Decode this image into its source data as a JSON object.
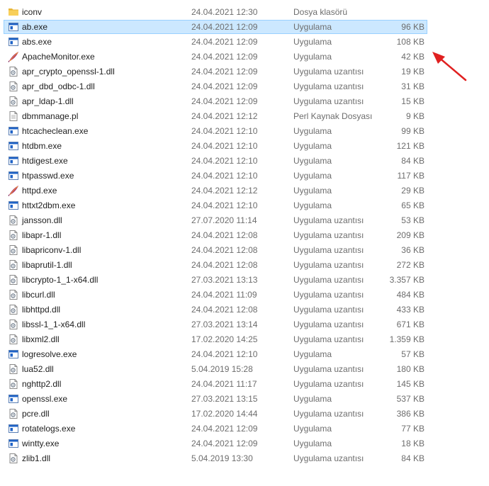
{
  "files": [
    {
      "name": "iconv",
      "date": "24.04.2021 12:30",
      "type": "Dosya klasörü",
      "size": "",
      "icon": "folder-icon",
      "selected": false
    },
    {
      "name": "ab.exe",
      "date": "24.04.2021 12:09",
      "type": "Uygulama",
      "size": "96 KB",
      "icon": "app-icon",
      "selected": true
    },
    {
      "name": "abs.exe",
      "date": "24.04.2021 12:09",
      "type": "Uygulama",
      "size": "108 KB",
      "icon": "app-icon",
      "selected": false
    },
    {
      "name": "ApacheMonitor.exe",
      "date": "24.04.2021 12:09",
      "type": "Uygulama",
      "size": "42 KB",
      "icon": "apache-feather-icon",
      "selected": false
    },
    {
      "name": "apr_crypto_openssl-1.dll",
      "date": "24.04.2021 12:09",
      "type": "Uygulama uzantısı",
      "size": "19 KB",
      "icon": "dll-icon",
      "selected": false
    },
    {
      "name": "apr_dbd_odbc-1.dll",
      "date": "24.04.2021 12:09",
      "type": "Uygulama uzantısı",
      "size": "31 KB",
      "icon": "dll-icon",
      "selected": false
    },
    {
      "name": "apr_ldap-1.dll",
      "date": "24.04.2021 12:09",
      "type": "Uygulama uzantısı",
      "size": "15 KB",
      "icon": "dll-icon",
      "selected": false
    },
    {
      "name": "dbmmanage.pl",
      "date": "24.04.2021 12:12",
      "type": "Perl Kaynak Dosyası",
      "size": "9 KB",
      "icon": "text-file-icon",
      "selected": false
    },
    {
      "name": "htcacheclean.exe",
      "date": "24.04.2021 12:10",
      "type": "Uygulama",
      "size": "99 KB",
      "icon": "app-icon",
      "selected": false
    },
    {
      "name": "htdbm.exe",
      "date": "24.04.2021 12:10",
      "type": "Uygulama",
      "size": "121 KB",
      "icon": "app-icon",
      "selected": false
    },
    {
      "name": "htdigest.exe",
      "date": "24.04.2021 12:10",
      "type": "Uygulama",
      "size": "84 KB",
      "icon": "app-icon",
      "selected": false
    },
    {
      "name": "htpasswd.exe",
      "date": "24.04.2021 12:10",
      "type": "Uygulama",
      "size": "117 KB",
      "icon": "app-icon",
      "selected": false
    },
    {
      "name": "httpd.exe",
      "date": "24.04.2021 12:12",
      "type": "Uygulama",
      "size": "29 KB",
      "icon": "apache-feather-icon",
      "selected": false
    },
    {
      "name": "httxt2dbm.exe",
      "date": "24.04.2021 12:10",
      "type": "Uygulama",
      "size": "65 KB",
      "icon": "app-icon",
      "selected": false
    },
    {
      "name": "jansson.dll",
      "date": "27.07.2020 11:14",
      "type": "Uygulama uzantısı",
      "size": "53 KB",
      "icon": "dll-icon",
      "selected": false
    },
    {
      "name": "libapr-1.dll",
      "date": "24.04.2021 12:08",
      "type": "Uygulama uzantısı",
      "size": "209 KB",
      "icon": "dll-icon",
      "selected": false
    },
    {
      "name": "libapriconv-1.dll",
      "date": "24.04.2021 12:08",
      "type": "Uygulama uzantısı",
      "size": "36 KB",
      "icon": "dll-icon",
      "selected": false
    },
    {
      "name": "libaprutil-1.dll",
      "date": "24.04.2021 12:08",
      "type": "Uygulama uzantısı",
      "size": "272 KB",
      "icon": "dll-icon",
      "selected": false
    },
    {
      "name": "libcrypto-1_1-x64.dll",
      "date": "27.03.2021 13:13",
      "type": "Uygulama uzantısı",
      "size": "3.357 KB",
      "icon": "dll-icon",
      "selected": false
    },
    {
      "name": "libcurl.dll",
      "date": "24.04.2021 11:09",
      "type": "Uygulama uzantısı",
      "size": "484 KB",
      "icon": "dll-icon",
      "selected": false
    },
    {
      "name": "libhttpd.dll",
      "date": "24.04.2021 12:08",
      "type": "Uygulama uzantısı",
      "size": "433 KB",
      "icon": "dll-icon",
      "selected": false
    },
    {
      "name": "libssl-1_1-x64.dll",
      "date": "27.03.2021 13:14",
      "type": "Uygulama uzantısı",
      "size": "671 KB",
      "icon": "dll-icon",
      "selected": false
    },
    {
      "name": "libxml2.dll",
      "date": "17.02.2020 14:25",
      "type": "Uygulama uzantısı",
      "size": "1.359 KB",
      "icon": "dll-icon",
      "selected": false
    },
    {
      "name": "logresolve.exe",
      "date": "24.04.2021 12:10",
      "type": "Uygulama",
      "size": "57 KB",
      "icon": "app-icon",
      "selected": false
    },
    {
      "name": "lua52.dll",
      "date": "5.04.2019 15:28",
      "type": "Uygulama uzantısı",
      "size": "180 KB",
      "icon": "dll-icon",
      "selected": false
    },
    {
      "name": "nghttp2.dll",
      "date": "24.04.2021 11:17",
      "type": "Uygulama uzantısı",
      "size": "145 KB",
      "icon": "dll-icon",
      "selected": false
    },
    {
      "name": "openssl.exe",
      "date": "27.03.2021 13:15",
      "type": "Uygulama",
      "size": "537 KB",
      "icon": "app-icon",
      "selected": false
    },
    {
      "name": "pcre.dll",
      "date": "17.02.2020 14:44",
      "type": "Uygulama uzantısı",
      "size": "386 KB",
      "icon": "dll-icon",
      "selected": false
    },
    {
      "name": "rotatelogs.exe",
      "date": "24.04.2021 12:09",
      "type": "Uygulama",
      "size": "77 KB",
      "icon": "app-icon",
      "selected": false
    },
    {
      "name": "wintty.exe",
      "date": "24.04.2021 12:09",
      "type": "Uygulama",
      "size": "18 KB",
      "icon": "app-icon",
      "selected": false
    },
    {
      "name": "zlib1.dll",
      "date": "5.04.2019 13:30",
      "type": "Uygulama uzantısı",
      "size": "84 KB",
      "icon": "dll-icon",
      "selected": false
    }
  ],
  "colors": {
    "selection_fill": "#cce8ff",
    "selection_border": "#99d1ff",
    "annotation_arrow": "#e02020",
    "folder": "#f5c342",
    "app_icon_blue": "#1f63c7"
  }
}
